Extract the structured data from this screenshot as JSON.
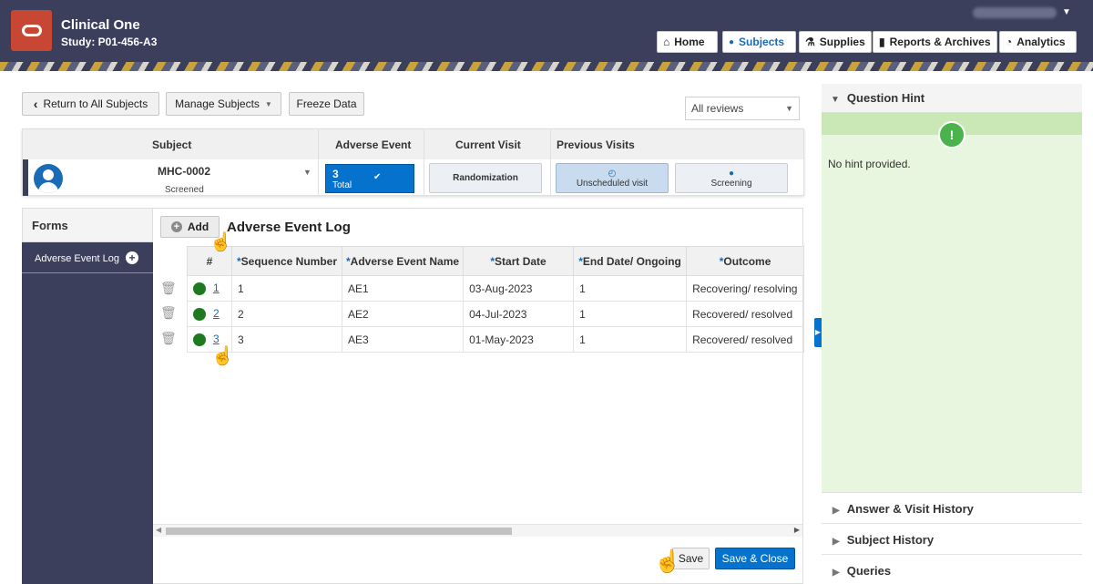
{
  "header": {
    "app_title": "Clinical One",
    "study": "Study: P01-456-A3",
    "nav": [
      {
        "label": "Home",
        "icon": "home-icon",
        "glyph": "⌂"
      },
      {
        "label": "Subjects",
        "icon": "person-icon",
        "glyph": "👤"
      },
      {
        "label": "Supplies",
        "icon": "supplies-icon",
        "glyph": "⚗"
      },
      {
        "label": "Reports & Archives",
        "icon": "bar-chart-icon",
        "glyph": "▮"
      },
      {
        "label": "Analytics",
        "icon": "gauge-icon",
        "glyph": "◔"
      }
    ]
  },
  "toolbar": {
    "return_label": "Return to All Subjects",
    "manage_label": "Manage Subjects",
    "freeze_label": "Freeze Data",
    "reviews_value": "All reviews"
  },
  "subject_card": {
    "headers": {
      "subject": "Subject",
      "adverse_event": "Adverse Event",
      "current_visit": "Current Visit",
      "previous_visits": "Previous Visits"
    },
    "subject_id": "MHC-0002",
    "subject_status": "Screened",
    "ae_count": "3",
    "ae_label": "Total",
    "current_visit": "Randomization",
    "previous_visits": [
      "Unscheduled visit",
      "Screening"
    ]
  },
  "forms": {
    "title": "Forms",
    "items": [
      "Adverse Event Log"
    ]
  },
  "main": {
    "add_label": "Add",
    "title": "Adverse Event Log",
    "columns": [
      "#",
      "Sequence Number",
      "Adverse Event Name",
      "Start Date",
      "End Date/ Ongoing",
      "Outcome"
    ],
    "required_mark": "*",
    "rows": [
      {
        "num": "1",
        "seq": "1",
        "name": "AE1",
        "start": "03-Aug-2023",
        "end": "1",
        "outcome": "Recovering/ resolving"
      },
      {
        "num": "2",
        "seq": "2",
        "name": "AE2",
        "start": "04-Jul-2023",
        "end": "1",
        "outcome": "Recovered/ resolved"
      },
      {
        "num": "3",
        "seq": "3",
        "name": "AE3",
        "start": "01-May-2023",
        "end": "1",
        "outcome": "Recovered/ resolved"
      }
    ],
    "save_label": "Save",
    "save_close_label": "Save & Close"
  },
  "right_panel": {
    "hint_title": "Question Hint",
    "hint_text": "No hint provided.",
    "accordions": [
      "Answer & Visit History",
      "Subject History",
      "Queries"
    ]
  },
  "colors": {
    "header_bg": "#3b3f5c",
    "accent": "#0572ce",
    "logo": "#c74634",
    "status_green": "#1f7a1f",
    "hint_bg": "#e9f6df"
  }
}
